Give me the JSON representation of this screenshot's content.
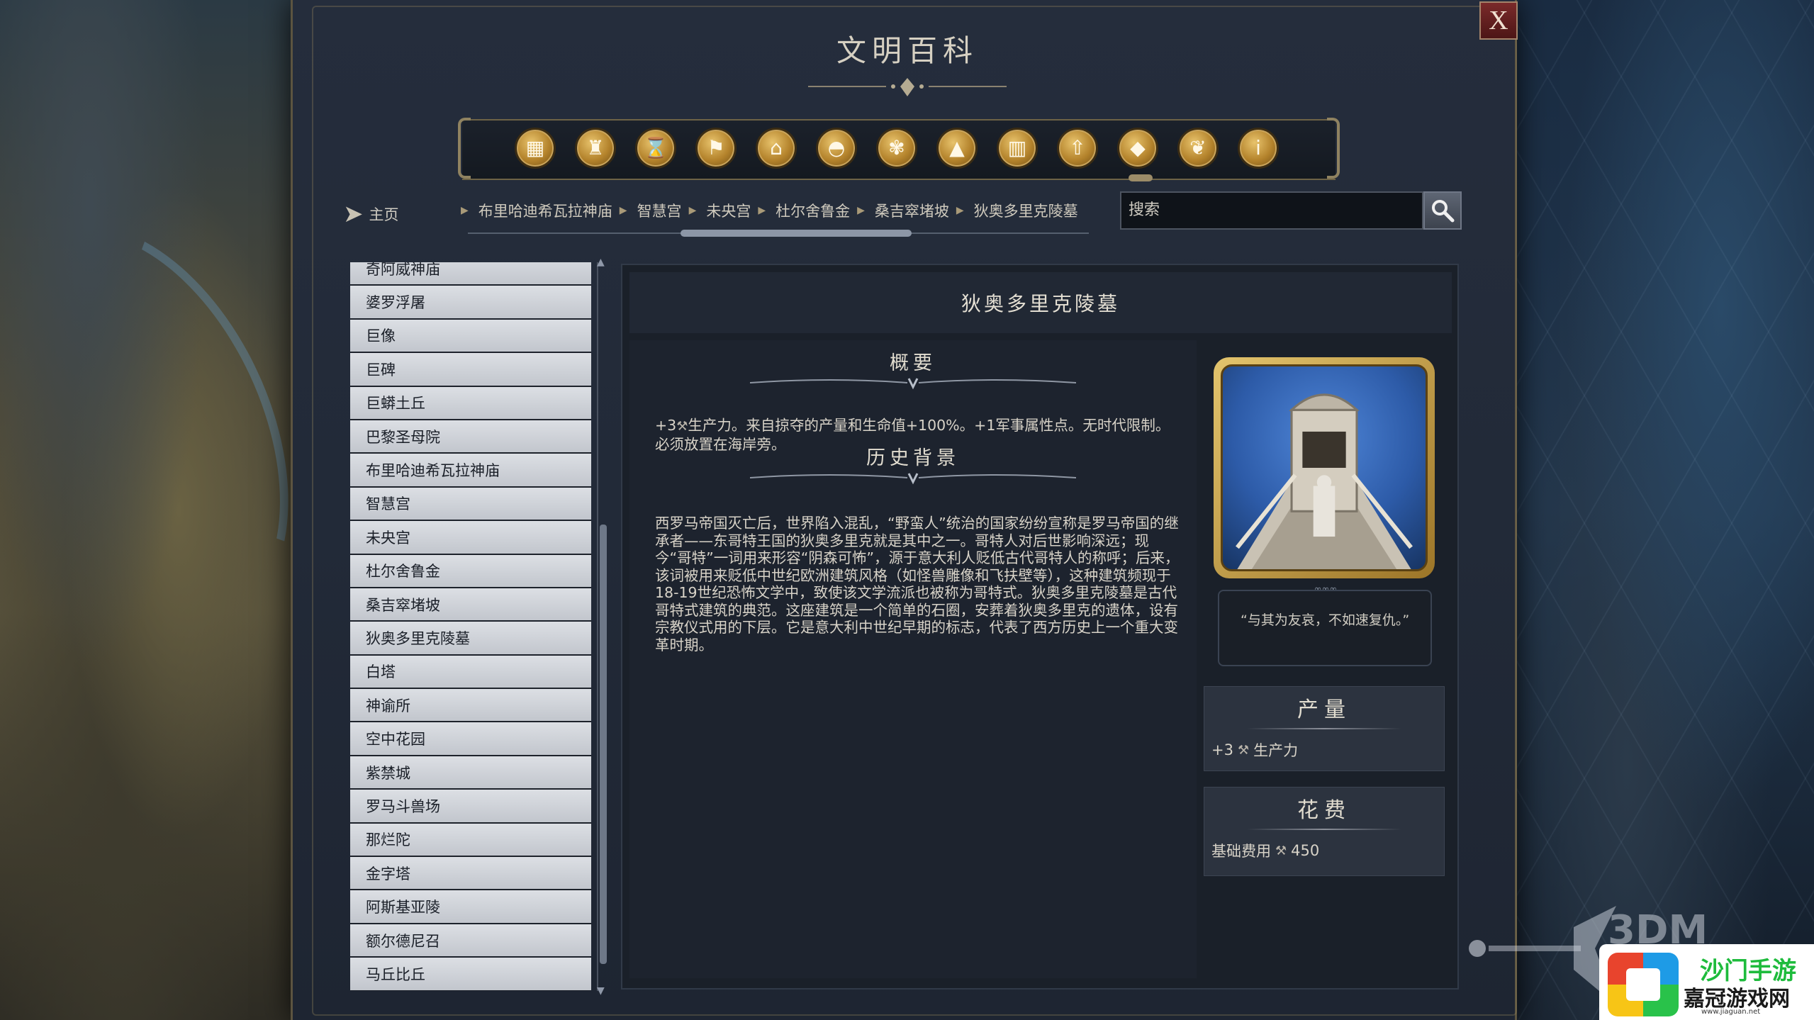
{
  "window": {
    "title": "文明百科",
    "close_label": "X"
  },
  "categories": [
    {
      "icon": "resources-icon"
    },
    {
      "icon": "goblet-icon"
    },
    {
      "icon": "hourglass-icon"
    },
    {
      "icon": "flag-icon"
    },
    {
      "icon": "government-building-icon"
    },
    {
      "icon": "district-dome-icon"
    },
    {
      "icon": "great-person-icon"
    },
    {
      "icon": "terrain-mountain-icon"
    },
    {
      "icon": "buildings-icon"
    },
    {
      "icon": "upgrade-arrow-icon"
    },
    {
      "icon": "wonder-pyramid-icon"
    },
    {
      "icon": "dove-icon"
    },
    {
      "icon": "info-icon"
    }
  ],
  "nav": {
    "home_label": "主页",
    "breadcrumbs": [
      "布里哈迪希瓦拉神庙",
      "智慧宫",
      "未央宫",
      "杜尔舍鲁金",
      "桑吉窣堵坡",
      "狄奥多里克陵墓"
    ],
    "search_placeholder": "搜索"
  },
  "list": [
    "奇阿威神庙",
    "婆罗浮屠",
    "巨像",
    "巨碑",
    "巨蟒土丘",
    "巴黎圣母院",
    "布里哈迪希瓦拉神庙",
    "智慧宫",
    "未央宫",
    "杜尔舍鲁金",
    "桑吉窣堵坡",
    "狄奥多里克陵墓",
    "白塔",
    "神谕所",
    "空中花园",
    "紫禁城",
    "罗马斗兽场",
    "那烂陀",
    "金字塔",
    "阿斯基亚陵",
    "额尔德尼召",
    "马丘比丘"
  ],
  "detail": {
    "title": "狄奥多里克陵墓",
    "overview_heading": "概要",
    "overview_prefix": "+3",
    "overview_text": "生产力。来自掠夺的产量和生命值+100%。+1军事属性点。无时代限制。必须放置在海岸旁。",
    "history_heading": "历史背景",
    "history_text": "西罗马帝国灭亡后，世界陷入混乱，“野蛮人”统治的国家纷纷宣称是罗马帝国的继承者——东哥特王国的狄奥多里克就是其中之一。哥特人对后世影响深远；现今“哥特”一词用来形容“阴森可怖”，源于意大利人贬低古代哥特人的称呼；后来，该词被用来贬低中世纪欧洲建筑风格（如怪兽雕像和飞扶壁等），这种建筑频现于18-19世纪恐怖文学中，致使该文学流派也被称为哥特式。狄奥多里克陵墓是古代哥特式建筑的典范。这座建筑是一个简单的石圈，安葬着狄奥多里克的遗体，设有宗教仪式用的下层。它是意大利中世纪早期的标志，代表了西方历史上一个重大变革时期。",
    "quote": "“与其为友哀，不如速复仇。”",
    "yield_heading": "产量",
    "yield_value": "+3",
    "yield_label": "生产力",
    "cost_heading": "花费",
    "cost_label": "基础费用",
    "cost_value": "450"
  },
  "watermark": {
    "brand": "3DM",
    "site_name": "嘉冠游戏网",
    "green_text": "沙门手游",
    "url": "www.jiaguan.net"
  },
  "colors": {
    "gold_icon": "#c9a45b",
    "list_bg": "#d0d3d9",
    "panel_bg": "#222a38",
    "close_red": "#6a2424"
  }
}
